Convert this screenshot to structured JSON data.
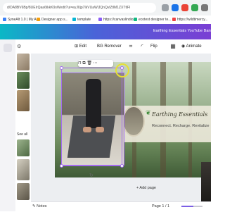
{
  "browser": {
    "url": "d/DA8BV6Bp/8UEIrQaa6tkkK9sWedit?ui=eyJIIjp7IkVUaWlJQnQvlZtlM1ZXTtlFI",
    "bookmarks": [
      {
        "label": "SyneAlt 1.0 | My Ac...",
        "color": "#3b82f6"
      },
      {
        "label": "Designer app s...",
        "color": "#f59e0b"
      },
      {
        "label": "template",
        "color": "#06b6d4"
      },
      {
        "label": "https://canvaslindio...",
        "color": "#8b5cf6"
      },
      {
        "label": "ecotest designer te...",
        "color": "#10b981"
      },
      {
        "label": "https://wildtimercy...",
        "color": "#ef4444"
      }
    ]
  },
  "canva": {
    "project_title": "Earthing Essentials YouTube Banner"
  },
  "panel": {
    "label": "See all"
  },
  "toolbar": {
    "edit_label": "Edit",
    "bg_remover_label": "BG Remover",
    "flip_label": "Flip",
    "animate_label": "Animate"
  },
  "design": {
    "brand_name": "Earthing Essentials",
    "tagline": "Reconnect. Recharge. Revitalize",
    "add_page_label": "+ Add page"
  },
  "footer": {
    "notes_label": "Notes",
    "page_indicator": "Page 1 / 1",
    "zoom_level": 0.55
  },
  "colors": {
    "selection": "#a46cf0",
    "header_gradient_start": "#0bb8c6",
    "header_gradient_end": "#7a3fd4"
  }
}
